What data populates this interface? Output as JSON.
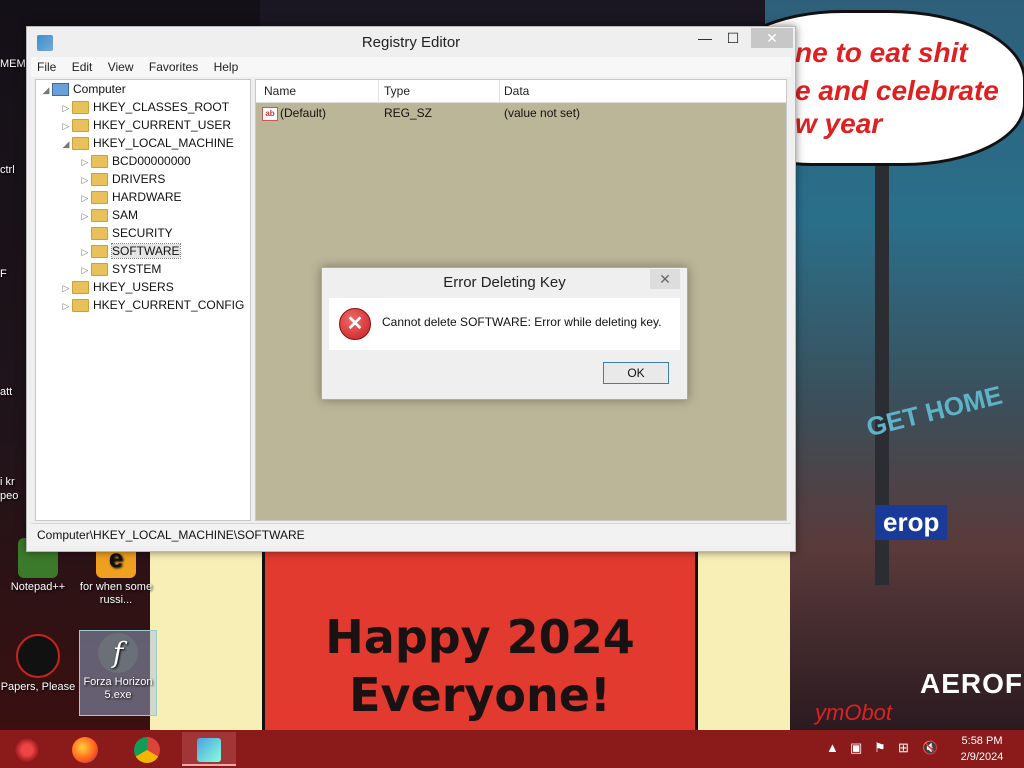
{
  "wallpaper": {
    "bubble_line1": "ne to eat shit",
    "bubble_line2": "e and celebrate",
    "bubble_line3": "w year",
    "happy_line1": "Happy 2024",
    "happy_line2": "Everyone!",
    "get_home": "GET HOME",
    "erop": "erop",
    "erofos": "AEROFOS",
    "signature": "ymObot"
  },
  "desktop_icons": {
    "notepad": "Notepad++",
    "for_when": "for when some russi...",
    "papers": "Papers, Please",
    "forza": "Forza Horizon 5.exe",
    "edge_labels": [
      "MEM",
      "ctrl",
      "F",
      "att",
      "i kr",
      "peo"
    ]
  },
  "window": {
    "title": "Registry Editor",
    "controls": {
      "minimize": "—",
      "maximize": "☐",
      "close": "✕"
    },
    "menu": [
      "File",
      "Edit",
      "View",
      "Favorites",
      "Help"
    ],
    "tree": {
      "root": "Computer",
      "hives": [
        "HKEY_CLASSES_ROOT",
        "HKEY_CURRENT_USER",
        "HKEY_LOCAL_MACHINE"
      ],
      "hklm_children": [
        "BCD00000000",
        "DRIVERS",
        "HARDWARE",
        "SAM",
        "SECURITY",
        "SOFTWARE",
        "SYSTEM"
      ],
      "hives_after": [
        "HKEY_USERS",
        "HKEY_CURRENT_CONFIG"
      ],
      "selected": "SOFTWARE"
    },
    "columns": [
      "Name",
      "Type",
      "Data"
    ],
    "rows": [
      {
        "name": "(Default)",
        "type": "REG_SZ",
        "data": "(value not set)",
        "icon": "ab"
      }
    ],
    "status_path": "Computer\\HKEY_LOCAL_MACHINE\\SOFTWARE"
  },
  "dialog": {
    "title": "Error Deleting Key",
    "message": "Cannot delete SOFTWARE:  Error while deleting key.",
    "ok_label": "OK",
    "close": "✕",
    "icon": "error-icon"
  },
  "taskbar": {
    "apps": [
      "start-orb",
      "firefox",
      "chrome",
      "regedit"
    ],
    "tray_chevron": "▲",
    "time": "5:58 PM",
    "date": "2/9/2024"
  }
}
